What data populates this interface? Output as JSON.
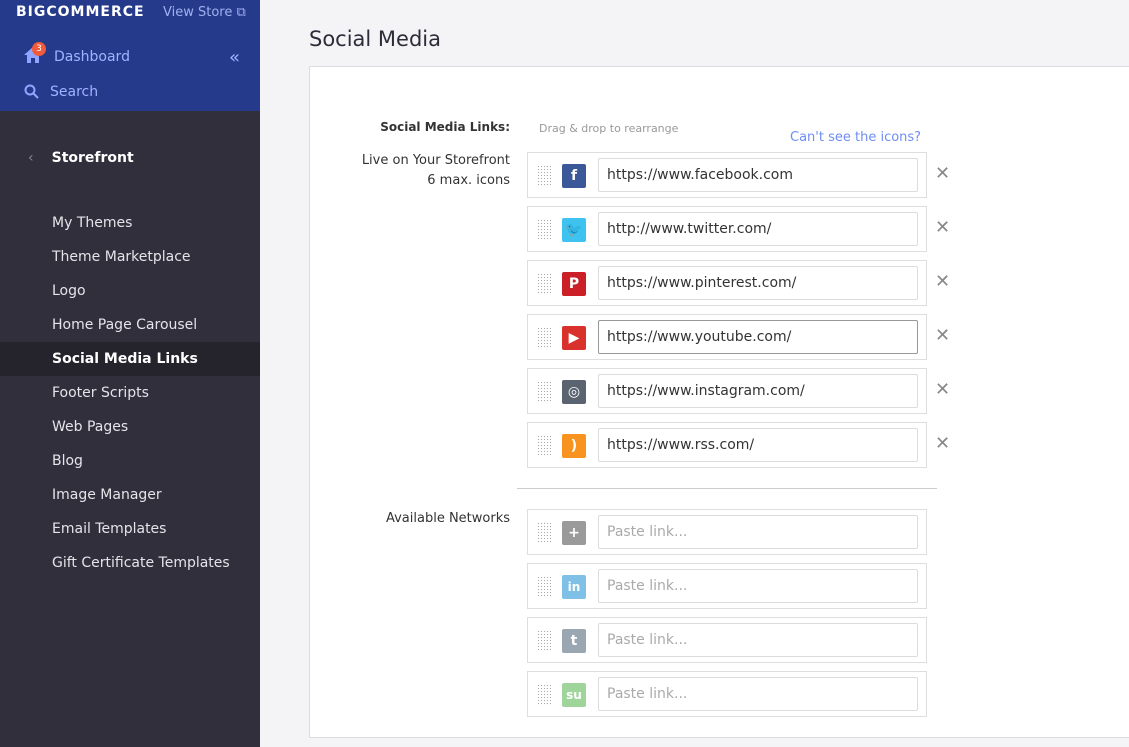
{
  "sidebar": {
    "logo": "BIGCOMMERCE",
    "view_store": "View Store",
    "badge": "3",
    "dashboard": "Dashboard",
    "search": "Search",
    "section": "Storefront",
    "items": [
      "My Themes",
      "Theme Marketplace",
      "Logo",
      "Home Page Carousel",
      "Social Media Links",
      "Footer Scripts",
      "Web Pages",
      "Blog",
      "Image Manager",
      "Email Templates",
      "Gift Certificate Templates"
    ],
    "active": "Social Media Links"
  },
  "page": {
    "title": "Social Media",
    "links_label": "Social Media Links:",
    "hint": "Drag & drop to rearrange",
    "cant_see": "Can't see the icons?",
    "live_label": "Live on Your Storefront",
    "max_label": "6 max. icons",
    "available_label": "Available Networks",
    "placeholder": "Paste link..."
  },
  "live": [
    {
      "network": "facebook",
      "glyph": "f",
      "color": "#3b5998",
      "url": "https://www.facebook.com"
    },
    {
      "network": "twitter",
      "glyph": "🐦",
      "color": "#3ec3f0",
      "url": "http://www.twitter.com/"
    },
    {
      "network": "pinterest",
      "glyph": "P",
      "color": "#cb2027",
      "url": "https://www.pinterest.com/"
    },
    {
      "network": "youtube",
      "glyph": "▶",
      "color": "#d9312b",
      "url": "https://www.youtube.com/"
    },
    {
      "network": "instagram",
      "glyph": "◎",
      "color": "#5a6370",
      "url": "https://www.instagram.com/"
    },
    {
      "network": "rss",
      "glyph": ")",
      "color": "#f7931e",
      "url": "https://www.rss.com/"
    }
  ],
  "available": [
    {
      "network": "google-plus",
      "glyph": "+",
      "color": "#9a9a9a"
    },
    {
      "network": "linkedin",
      "glyph": "in",
      "color": "#7fc1e6"
    },
    {
      "network": "tumblr",
      "glyph": "t",
      "color": "#9aa6b2"
    },
    {
      "network": "stumbleupon",
      "glyph": "su",
      "color": "#9fd59a"
    }
  ]
}
